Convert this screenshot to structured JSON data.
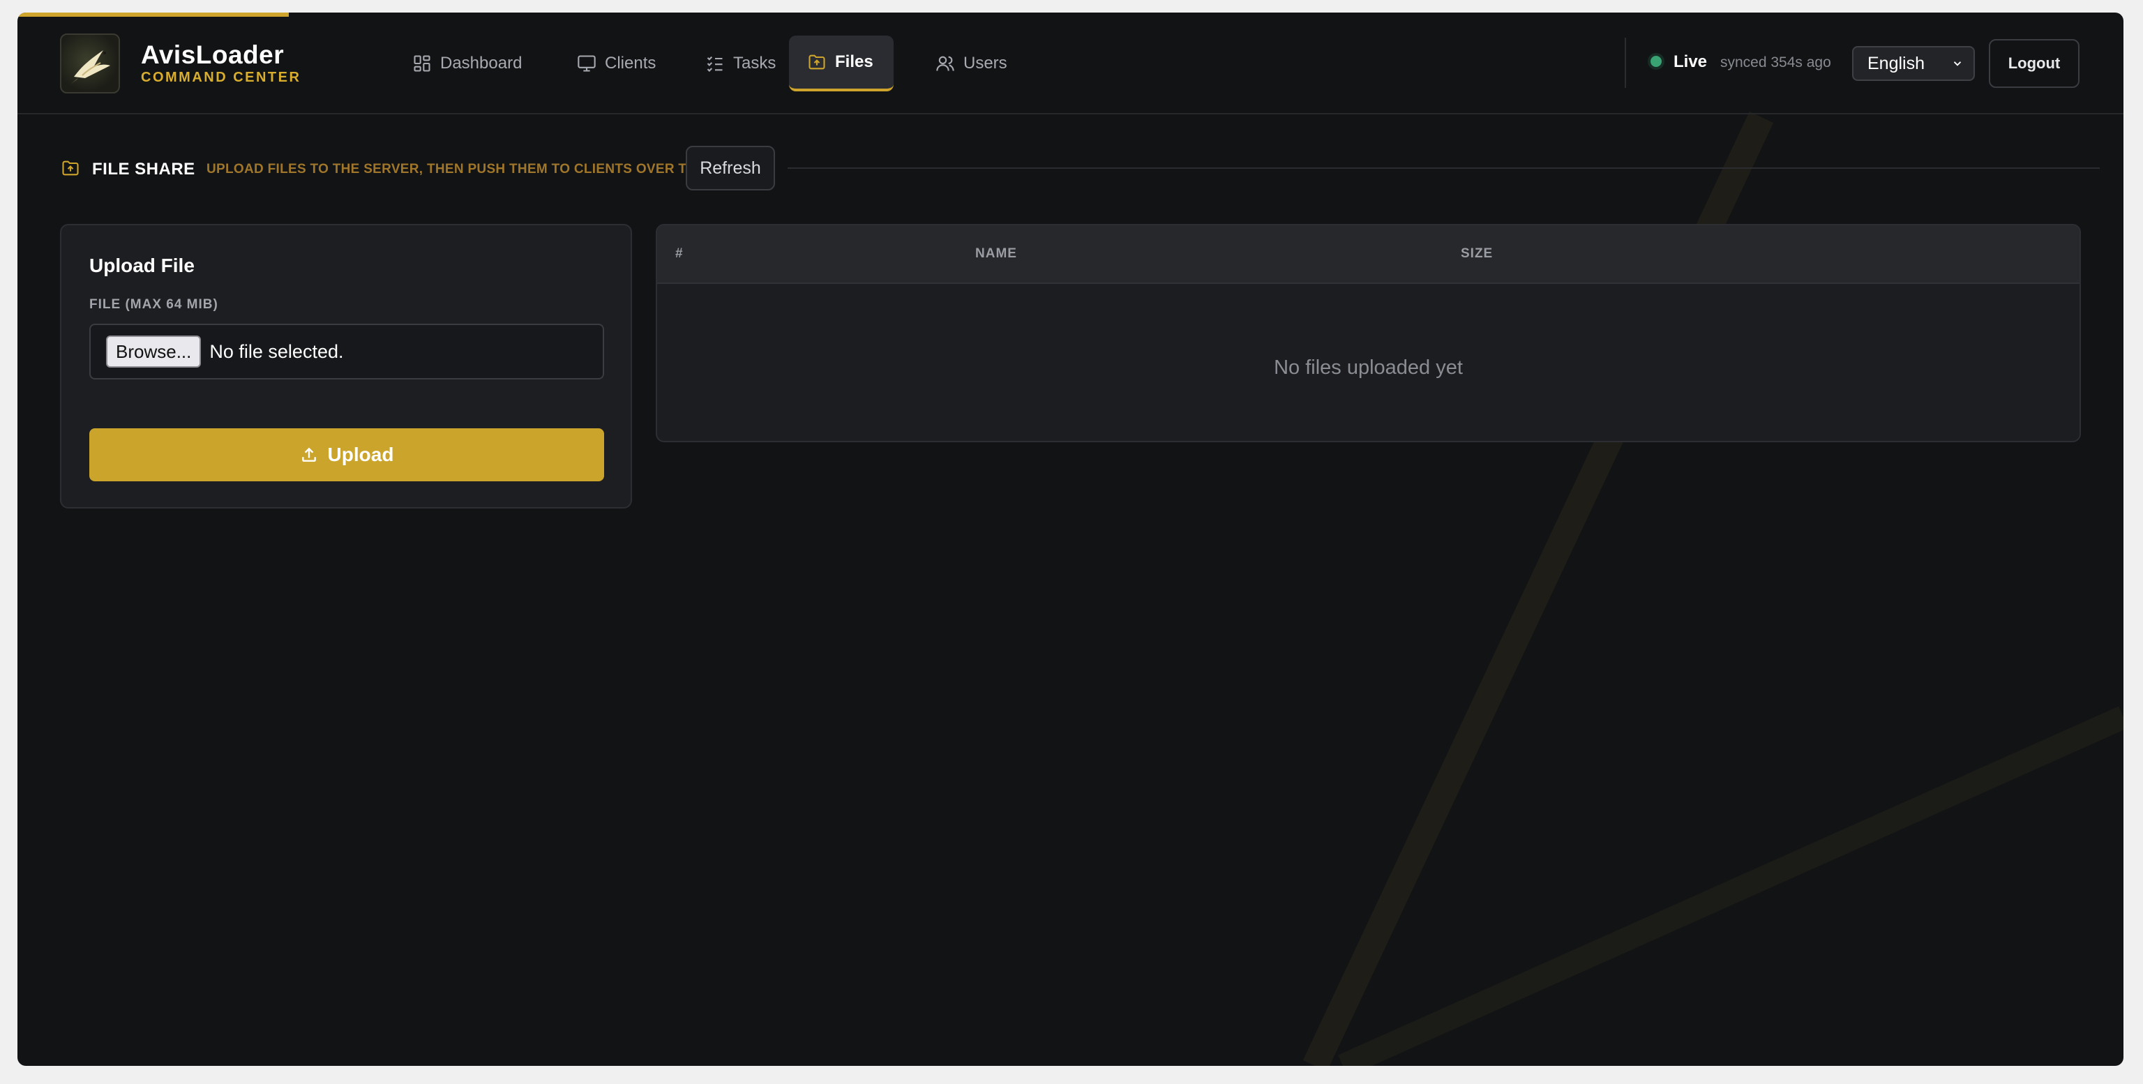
{
  "brand": {
    "name": "AvisLoader",
    "subtitle": "COMMAND CENTER"
  },
  "nav": [
    {
      "label": "Dashboard",
      "icon": "dashboard-icon",
      "active": false
    },
    {
      "label": "Clients",
      "icon": "monitor-icon",
      "active": false
    },
    {
      "label": "Tasks",
      "icon": "tasks-icon",
      "active": false
    },
    {
      "label": "Files",
      "icon": "folder-upload-icon",
      "active": true
    },
    {
      "label": "Users",
      "icon": "users-icon",
      "active": false
    }
  ],
  "status": {
    "live": "Live",
    "synced": "synced 354s ago"
  },
  "language": {
    "selected": "English"
  },
  "logout_label": "Logout",
  "section": {
    "title": "FILE SHARE",
    "subtitle": "UPLOAD FILES TO THE SERVER, THEN PUSH THEM TO CLIENTS OVER TOX",
    "refresh_label": "Refresh"
  },
  "upload": {
    "title": "Upload File",
    "field_label": "FILE (MAX 64 MIB)",
    "browse_label": "Browse...",
    "file_status": "No file selected.",
    "button_label": "Upload"
  },
  "table": {
    "columns": [
      "#",
      "NAME",
      "SIZE"
    ],
    "rows": [],
    "empty_message": "No files uploaded yet"
  },
  "colors": {
    "accent": "#cfa42c",
    "background": "#121315",
    "panel": "#1d1e22",
    "live": "#3aa373"
  }
}
